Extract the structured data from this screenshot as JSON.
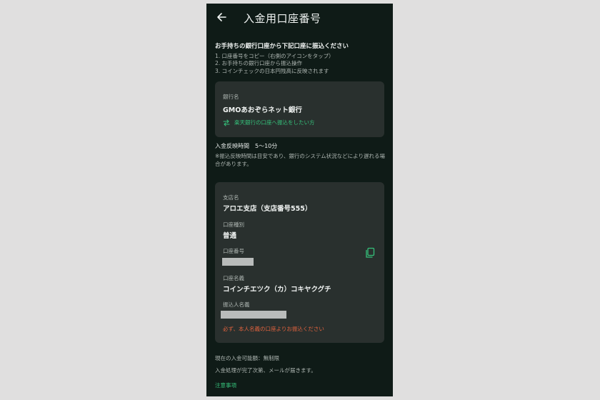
{
  "header": {
    "title": "入金用口座番号",
    "back_icon": "arrow-left-icon"
  },
  "instructions": {
    "heading": "お手持ちの銀行口座から下記口座に振込ください",
    "steps": [
      "1. 口座番号をコピー（右側のアイコンをタップ）",
      "2. お手持ちの銀行口座から振込操作",
      "3. コインチェックの日本円残高に反映されます"
    ]
  },
  "bank": {
    "label": "銀行名",
    "name": "GMOあおぞらネット銀行",
    "alt_link": "楽天銀行の口座へ振込をしたい方",
    "alt_icon": "swap-arrows-icon"
  },
  "reflect": {
    "time": "入金反映時間　5～10分",
    "note": "※振込反映時間は目安であり、銀行のシステム状況などにより遅れる場合があります。"
  },
  "account": {
    "branch_label": "支店名",
    "branch_value": "アロエ支店（支店番号555）",
    "type_label": "口座種別",
    "type_value": "普通",
    "number_label": "口座番号",
    "copy_icon": "copy-icon",
    "holder_label": "口座名義",
    "holder_value": "コインチエツク（カ）コキヤクグチ",
    "sender_label": "振込人名義",
    "warning": "必ず、本人名義の口座よりお振込ください"
  },
  "footer": {
    "limit": "現在の入金可能額：無制限",
    "mail": "入金処理が完了次第、メールが届きます。",
    "notes_link": "注意事項"
  },
  "colors": {
    "background": "#0f1b17",
    "card": "#29302e",
    "accent": "#35c07a",
    "warning": "#e0623e"
  }
}
